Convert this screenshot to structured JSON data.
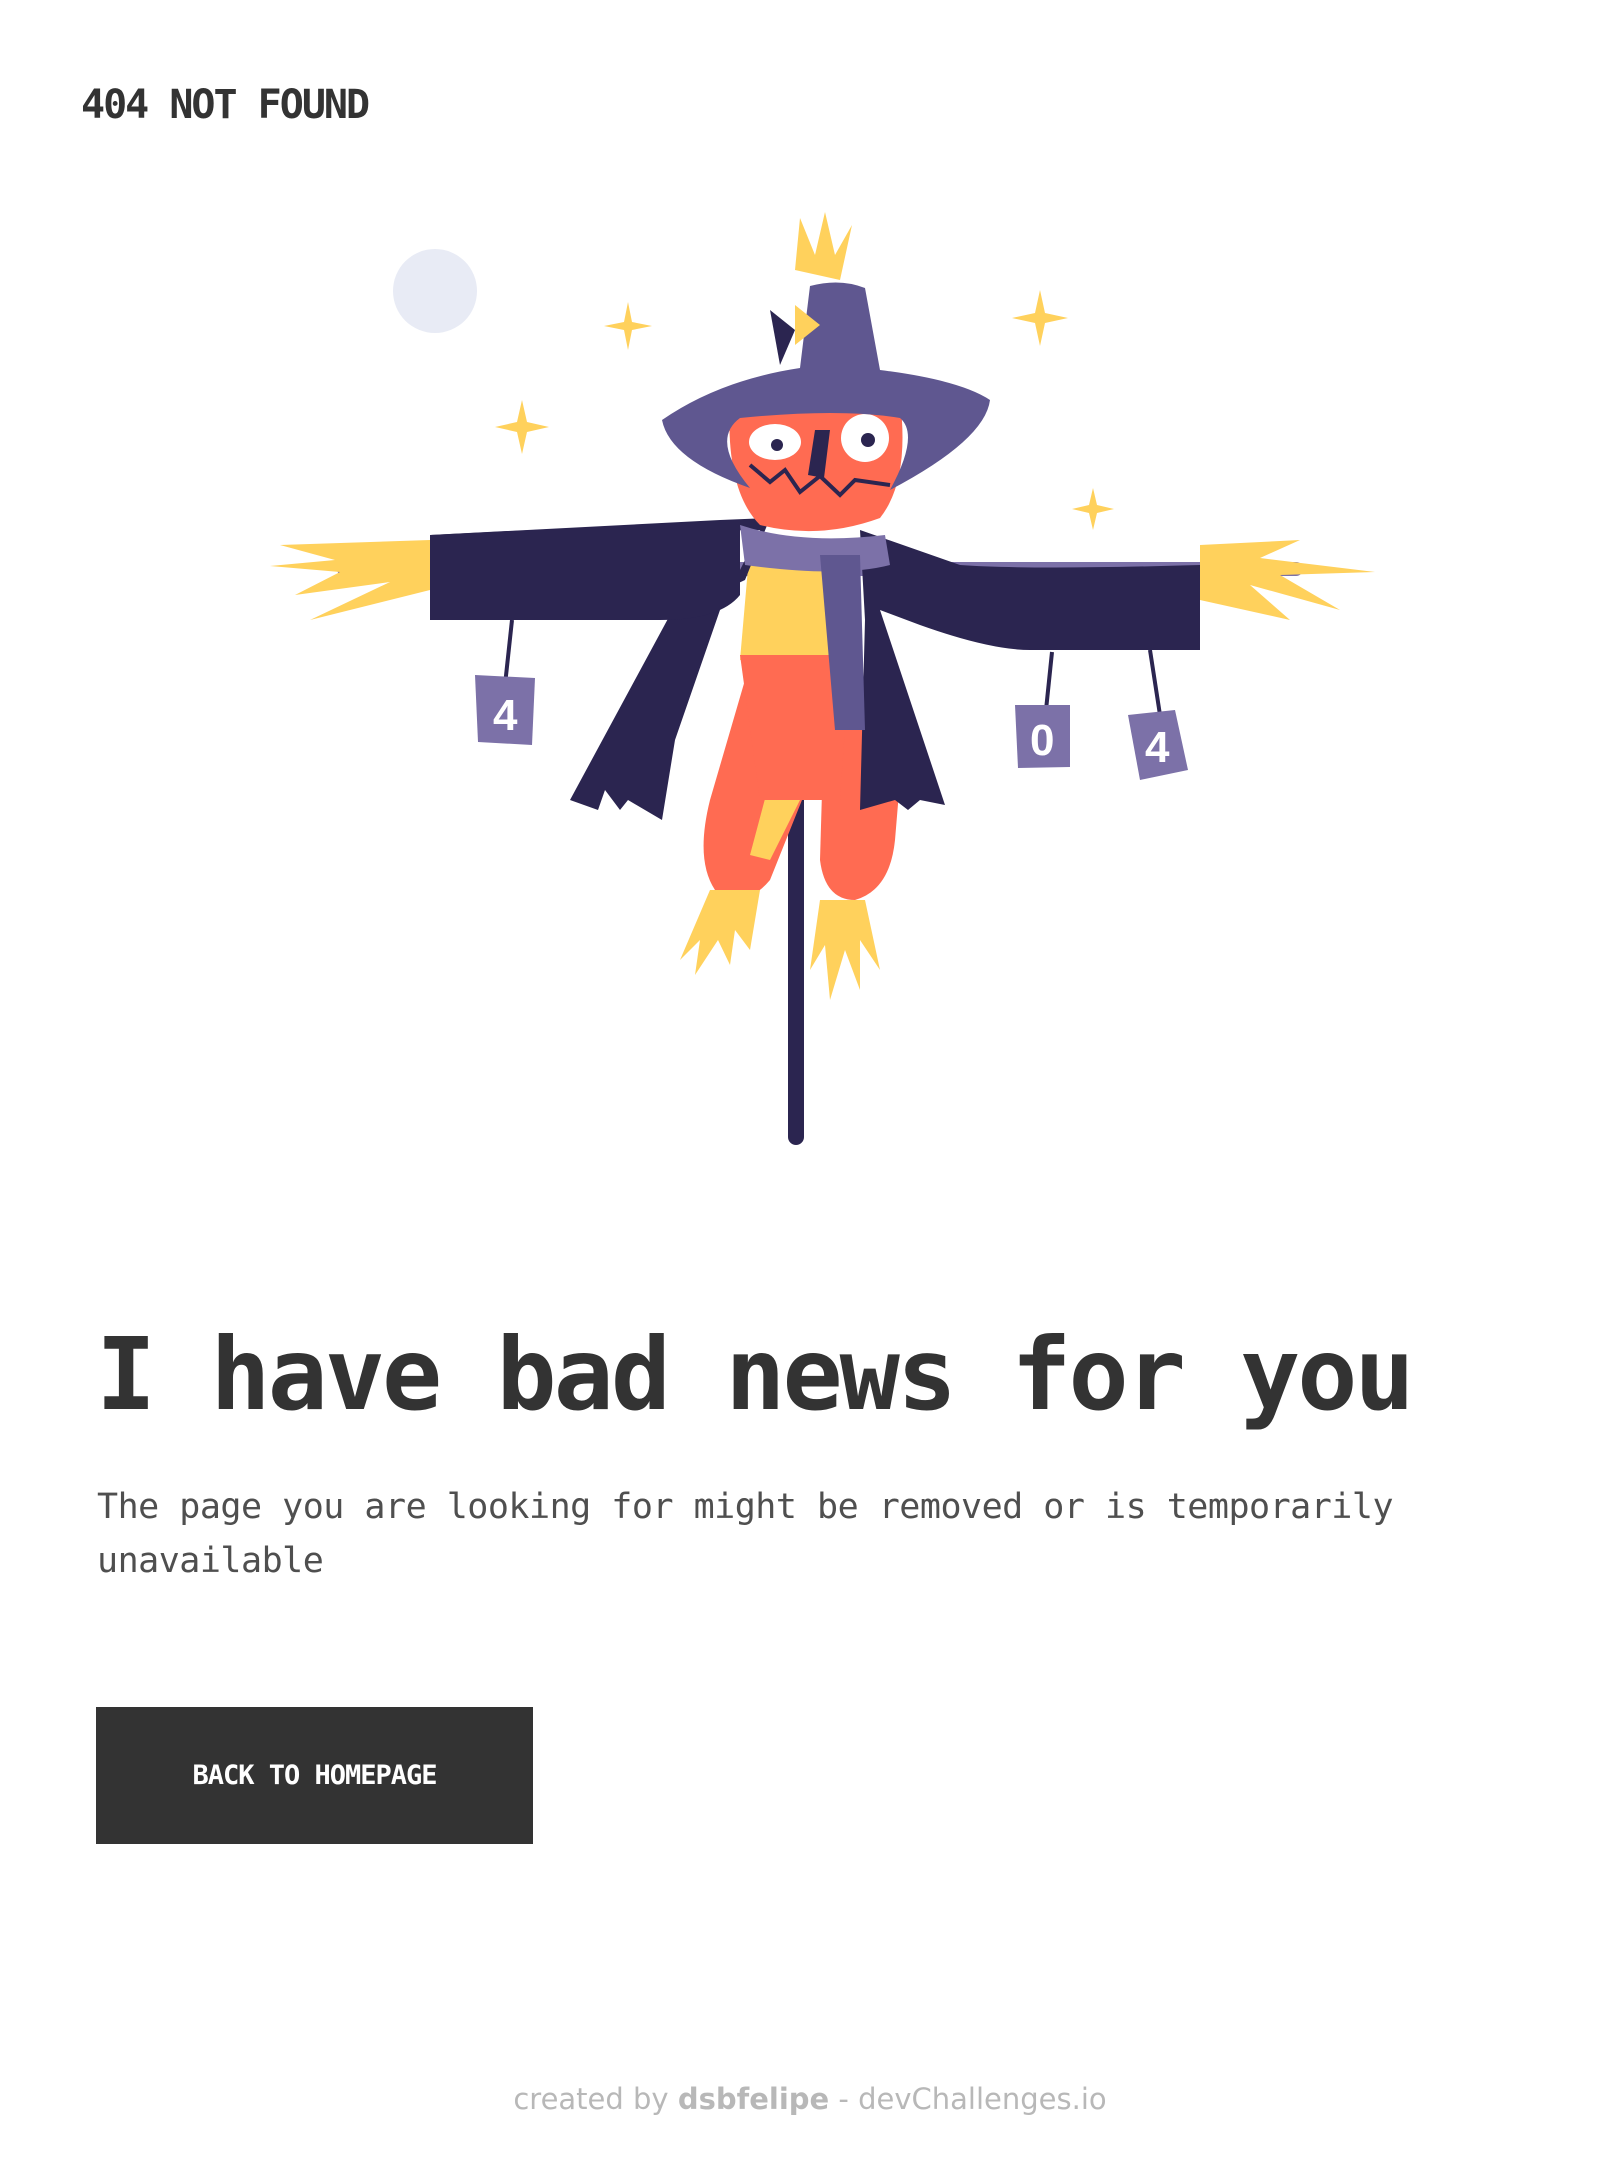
{
  "header": {
    "logo_text": "404 NOT FOUND"
  },
  "illustration": {
    "icon": "scarecrow-illustration",
    "can_labels": [
      "4",
      "0",
      "4"
    ],
    "colors": {
      "moon": "#e8ebf5",
      "star": "#ffd15c",
      "hat": "#5f5790",
      "hat_dark": "#2b2550",
      "face": "#ff6b52",
      "coat": "#2b2550",
      "scarf": "#5f5790",
      "straw": "#ffd15c",
      "can": "#7c71a8",
      "pole": "#2b2550"
    }
  },
  "main": {
    "headline": "I have bad news for you",
    "description": "The page you are looking for might be removed or is temporarily unavailable",
    "button_label": "BACK TO HOMEPAGE"
  },
  "footer": {
    "prefix": "created by",
    "author": "dsbfelipe",
    "separator": "-",
    "site": "devChallenges.io"
  }
}
